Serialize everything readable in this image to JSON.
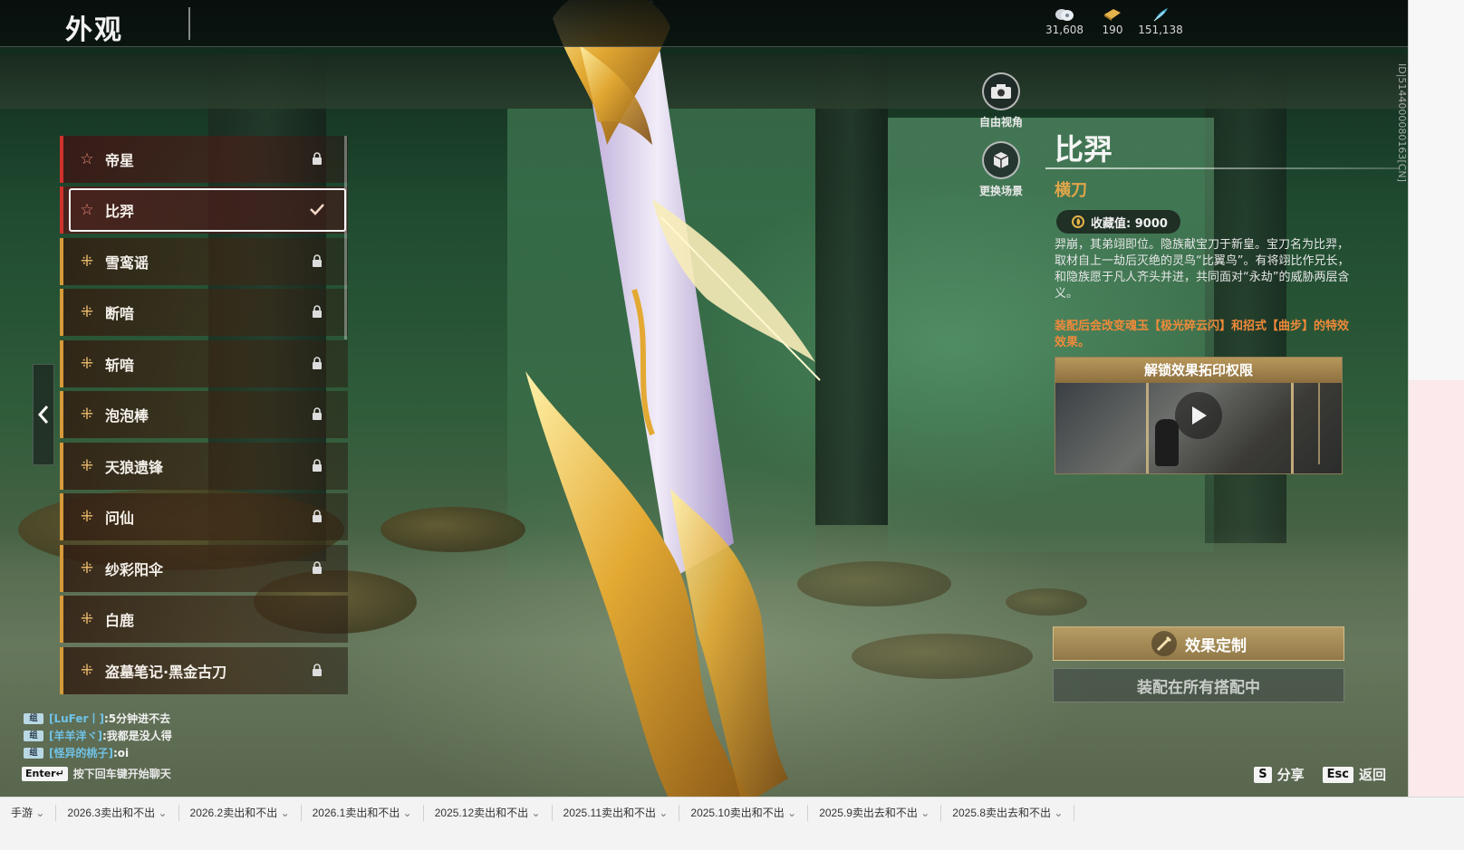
{
  "page": {
    "title": "外观"
  },
  "currency": [
    {
      "icon": "coin-icon",
      "value": "31,608"
    },
    {
      "icon": "ticket-icon",
      "value": "190"
    },
    {
      "icon": "feather-icon",
      "value": "151,138"
    }
  ],
  "skins": [
    {
      "name": "帝星",
      "rarity": "red",
      "icon": "star-icon",
      "state": "locked"
    },
    {
      "name": "比羿",
      "rarity": "red",
      "icon": "star-icon",
      "state": "equipped"
    },
    {
      "name": "雪鸾谣",
      "rarity": "gold",
      "icon": "cross-icon",
      "state": "locked"
    },
    {
      "name": "断喑",
      "rarity": "gold",
      "icon": "cross-icon",
      "state": "locked"
    },
    {
      "name": "斩喑",
      "rarity": "gold",
      "icon": "cross-icon",
      "state": "locked"
    },
    {
      "name": "泡泡棒",
      "rarity": "gold",
      "icon": "cross-icon",
      "state": "locked"
    },
    {
      "name": "天狼遗锋",
      "rarity": "gold",
      "icon": "cross-icon",
      "state": "locked"
    },
    {
      "name": "问仙",
      "rarity": "gold",
      "icon": "cross-icon",
      "state": "locked"
    },
    {
      "name": "纱彩阳伞",
      "rarity": "gold",
      "icon": "cross-icon",
      "state": "locked"
    },
    {
      "name": "白鹿",
      "rarity": "gold",
      "icon": "cross-icon",
      "state": "none"
    },
    {
      "name": "盗墓笔记·黑金古刀",
      "rarity": "gold",
      "icon": "cross-icon",
      "state": "locked"
    }
  ],
  "camera": {
    "free_view": "自由视角",
    "change_scene": "更换场景"
  },
  "detail": {
    "name": "比羿",
    "type": "横刀",
    "collect_label": "收藏值: 9000",
    "description": "羿崩，其弟翊即位。隐族献宝刀于新皇。宝刀名为比羿，取材自上一劫后灭绝的灵鸟“比翼鸟”。有将翊比作兄长，和隐族愿于凡人齐头并进，共同面对“永劫”的威胁两层含义。",
    "effect_note": "装配后会改变魂玉【极光碎云闪】和招式【曲步】的特效效果。",
    "unlock_title": "解锁效果拓印权限",
    "customize_label": "效果定制",
    "equip_label": "装配在所有搭配中"
  },
  "side_id": "ID|5144000080163[CN]",
  "chat": {
    "messages": [
      {
        "tag": "组",
        "name": "[LuFer丨]",
        "text": ":5分钟进不去"
      },
      {
        "tag": "组",
        "name": "[羊羊洋ヾ]",
        "text": ":我都是没人得"
      },
      {
        "tag": "组",
        "name": "[怪异的桃子]",
        "text": ":oi"
      }
    ],
    "hint_key": "Enter↵",
    "hint_text": "按下回车键开始聊天"
  },
  "shortcuts": {
    "share_key": "S",
    "share_label": "分享",
    "back_key": "Esc",
    "back_label": "返回"
  },
  "taskbar_tabs": [
    "手游",
    "2026.3卖出和不出",
    "2026.2卖出和不出",
    "2026.1卖出和不出",
    "2025.12卖出和不出",
    "2025.11卖出和不出",
    "2025.10卖出和不出",
    "2025.9卖出去和不出",
    "2025.8卖出去和不出"
  ],
  "colors": {
    "accent_gold": "#d69a3a",
    "accent_red": "#d0322c",
    "effect_orange": "#ef8a3a",
    "type_gold": "#e0a54a"
  }
}
